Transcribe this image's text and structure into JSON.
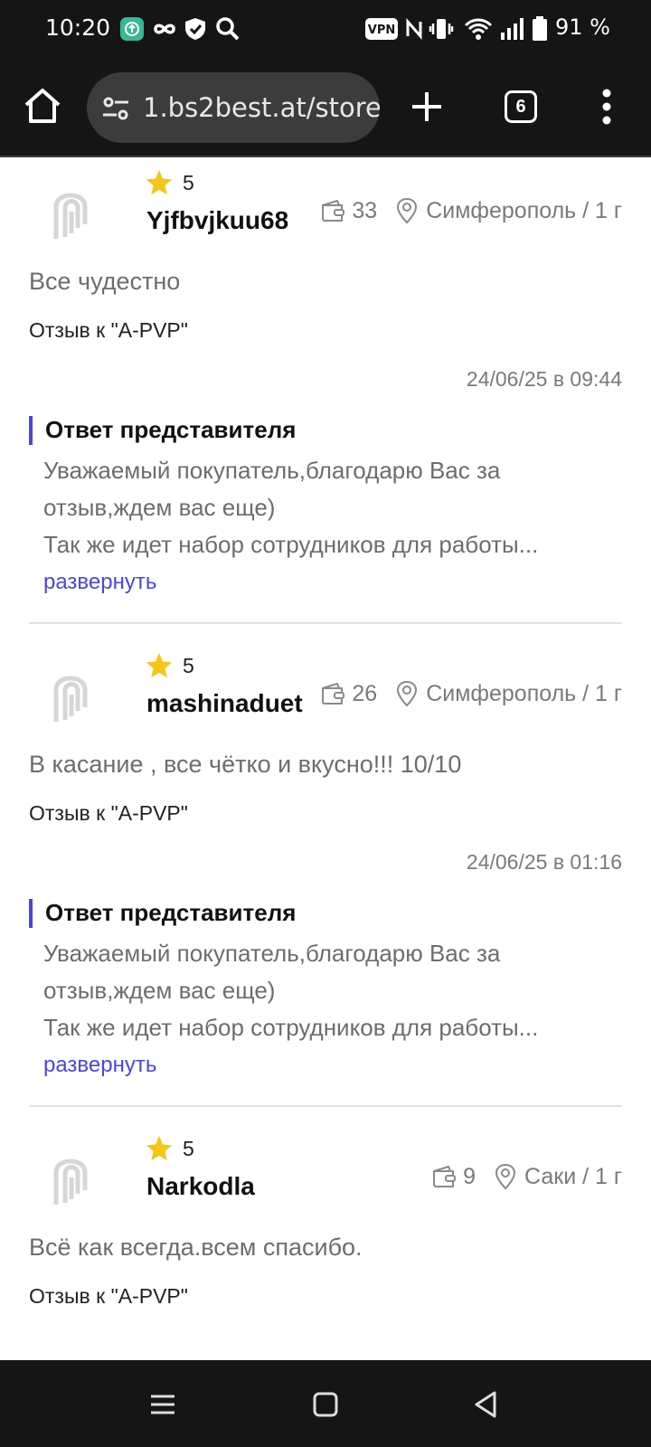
{
  "status_bar": {
    "time": "10:20",
    "battery": "91 %",
    "vpn": "VPN",
    "icons": [
      "app-icon",
      "infinity-icon",
      "shield-icon",
      "search-icon",
      "vpn-icon",
      "nfc-icon",
      "vibrate-icon",
      "wifi-icon",
      "signal-icon",
      "battery-icon"
    ]
  },
  "browser": {
    "url": "1.bs2best.at/store",
    "tab_count": "6",
    "icons": [
      "home-icon",
      "tune-icon",
      "plus-icon",
      "tabs-icon",
      "more-vert-icon"
    ]
  },
  "reviews": [
    {
      "rating": "5",
      "username": "Yjfbvjkuu68",
      "purchases": "33",
      "location": "Симферополь / 1 г",
      "text": "Все чудестно",
      "review_to": "Отзыв к \"A-PVP\"",
      "date": "24/06/25 в 09:44",
      "reply_title": "Ответ представителя",
      "reply_line1": "Уважаемый покупатель,благодарю Вас за",
      "reply_line2": "отзыв,ждем вас еще)",
      "reply_line3": "Так же идет набор сотрудников для работы...",
      "expand": "развернуть"
    },
    {
      "rating": "5",
      "username": "mashinaduet",
      "purchases": "26",
      "location": "Симферополь / 1 г",
      "text": "В касание , все чётко и вкусно!!! 10/10",
      "review_to": "Отзыв к \"A-PVP\"",
      "date": "24/06/25 в 01:16",
      "reply_title": "Ответ представителя",
      "reply_line1": "Уважаемый покупатель,благодарю Вас за",
      "reply_line2": "отзыв,ждем вас еще)",
      "reply_line3": "Так же идет набор сотрудников для работы...",
      "expand": "развернуть"
    },
    {
      "rating": "5",
      "username": "Narkodla",
      "purchases": "9",
      "location": "Саки / 1 г",
      "text": "Всё как всегда.всем спасибо.",
      "review_to": "Отзыв к \"A-PVP\""
    }
  ],
  "colors": {
    "accent": "#4b44e8",
    "star": "#f5c518",
    "system_bar": "#151515"
  }
}
